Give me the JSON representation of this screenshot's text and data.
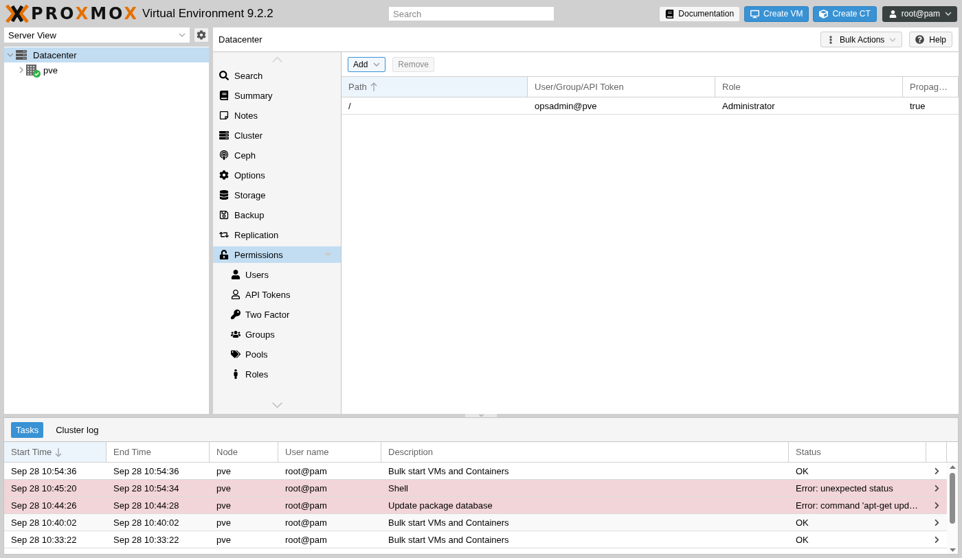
{
  "top_bar": {
    "logo": {
      "parts": [
        {
          "text": "PRO",
          "accent": false
        },
        {
          "text": "X",
          "accent": true
        },
        {
          "text": "MO",
          "accent": false
        },
        {
          "text": "X",
          "accent": true
        }
      ]
    },
    "product": "Virtual Environment 9.2.2",
    "search": {
      "placeholder": "Search"
    },
    "buttons": [
      {
        "label": "Documentation",
        "kind": "plain"
      },
      {
        "label": "Create VM",
        "kind": "primary"
      },
      {
        "label": "Create CT",
        "kind": "primary"
      }
    ],
    "user_menu": {
      "label": "root@pam"
    }
  },
  "resource_tree": {
    "view_select": {
      "value": "Server View"
    },
    "items": [
      {
        "label": "Datacenter",
        "kind": "datacenter",
        "selected": true,
        "expanded": true,
        "children": [
          {
            "label": "pve",
            "kind": "node",
            "selected": false,
            "expanded": false,
            "online": true
          }
        ]
      }
    ]
  },
  "content": {
    "title": "Datacenter",
    "header_buttons": [
      {
        "label": "Bulk Actions",
        "kind": "menu"
      },
      {
        "label": "Help",
        "kind": "help"
      }
    ],
    "nav": {
      "items": [
        {
          "label": "Search",
          "selected": false
        },
        {
          "label": "Summary",
          "selected": false
        },
        {
          "label": "Notes",
          "selected": false
        },
        {
          "label": "Cluster",
          "selected": false
        },
        {
          "label": "Ceph",
          "selected": false
        },
        {
          "label": "Options",
          "selected": false
        },
        {
          "label": "Storage",
          "selected": false
        },
        {
          "label": "Backup",
          "selected": false
        },
        {
          "label": "Replication",
          "selected": false
        },
        {
          "label": "Permissions",
          "selected": true,
          "expanded": true,
          "children": [
            {
              "label": "Users",
              "selected": false
            },
            {
              "label": "API Tokens",
              "selected": false
            },
            {
              "label": "Two Factor",
              "selected": false
            },
            {
              "label": "Groups",
              "selected": false
            },
            {
              "label": "Pools",
              "selected": false
            },
            {
              "label": "Roles",
              "selected": false
            }
          ]
        }
      ]
    },
    "toolbar": {
      "buttons": [
        {
          "label": "Add",
          "kind": "menu",
          "focused": true,
          "disabled": false
        },
        {
          "label": "Remove",
          "kind": "plain",
          "focused": false,
          "disabled": true
        }
      ]
    },
    "table": {
      "columns": [
        {
          "label": "Path",
          "sorted": true,
          "descending": false
        },
        {
          "label": "User/Group/API Token",
          "sorted": false
        },
        {
          "label": "Role",
          "sorted": false
        },
        {
          "label": "Propag…",
          "sorted": false
        }
      ],
      "rows": [
        {
          "cells": [
            "/",
            "opsadmin@pve",
            "Administrator",
            "true"
          ],
          "selected": false
        }
      ]
    }
  },
  "bottom_panel": {
    "tabs": [
      {
        "label": "Tasks",
        "selected": true
      },
      {
        "label": "Cluster log",
        "selected": false
      }
    ],
    "table": {
      "columns": [
        {
          "label": "Start Time",
          "sorted": true,
          "descending": true
        },
        {
          "label": "End Time",
          "sorted": false
        },
        {
          "label": "Node",
          "sorted": false
        },
        {
          "label": "User name",
          "sorted": false
        },
        {
          "label": "Description",
          "sorted": false
        },
        {
          "label": "Status",
          "sorted": false
        }
      ],
      "rows": [
        {
          "cells": [
            "Sep 28 10:54:36",
            "Sep 28 10:54:36",
            "pve",
            "root@pam",
            "Bulk start VMs and Containers",
            "OK"
          ],
          "error": false
        },
        {
          "cells": [
            "Sep 28 10:45:20",
            "Sep 28 10:54:34",
            "pve",
            "root@pam",
            "Shell",
            "Error: unexpected status"
          ],
          "error": true
        },
        {
          "cells": [
            "Sep 28 10:44:26",
            "Sep 28 10:44:28",
            "pve",
            "root@pam",
            "Update package database",
            "Error: command 'apt-get upd…"
          ],
          "error": true
        },
        {
          "cells": [
            "Sep 28 10:40:02",
            "Sep 28 10:40:02",
            "pve",
            "root@pam",
            "Bulk start VMs and Containers",
            "OK"
          ],
          "error": false
        },
        {
          "cells": [
            "Sep 28 10:33:22",
            "Sep 28 10:33:22",
            "pve",
            "root@pam",
            "Bulk start VMs and Containers",
            "OK"
          ],
          "error": false
        }
      ]
    }
  }
}
